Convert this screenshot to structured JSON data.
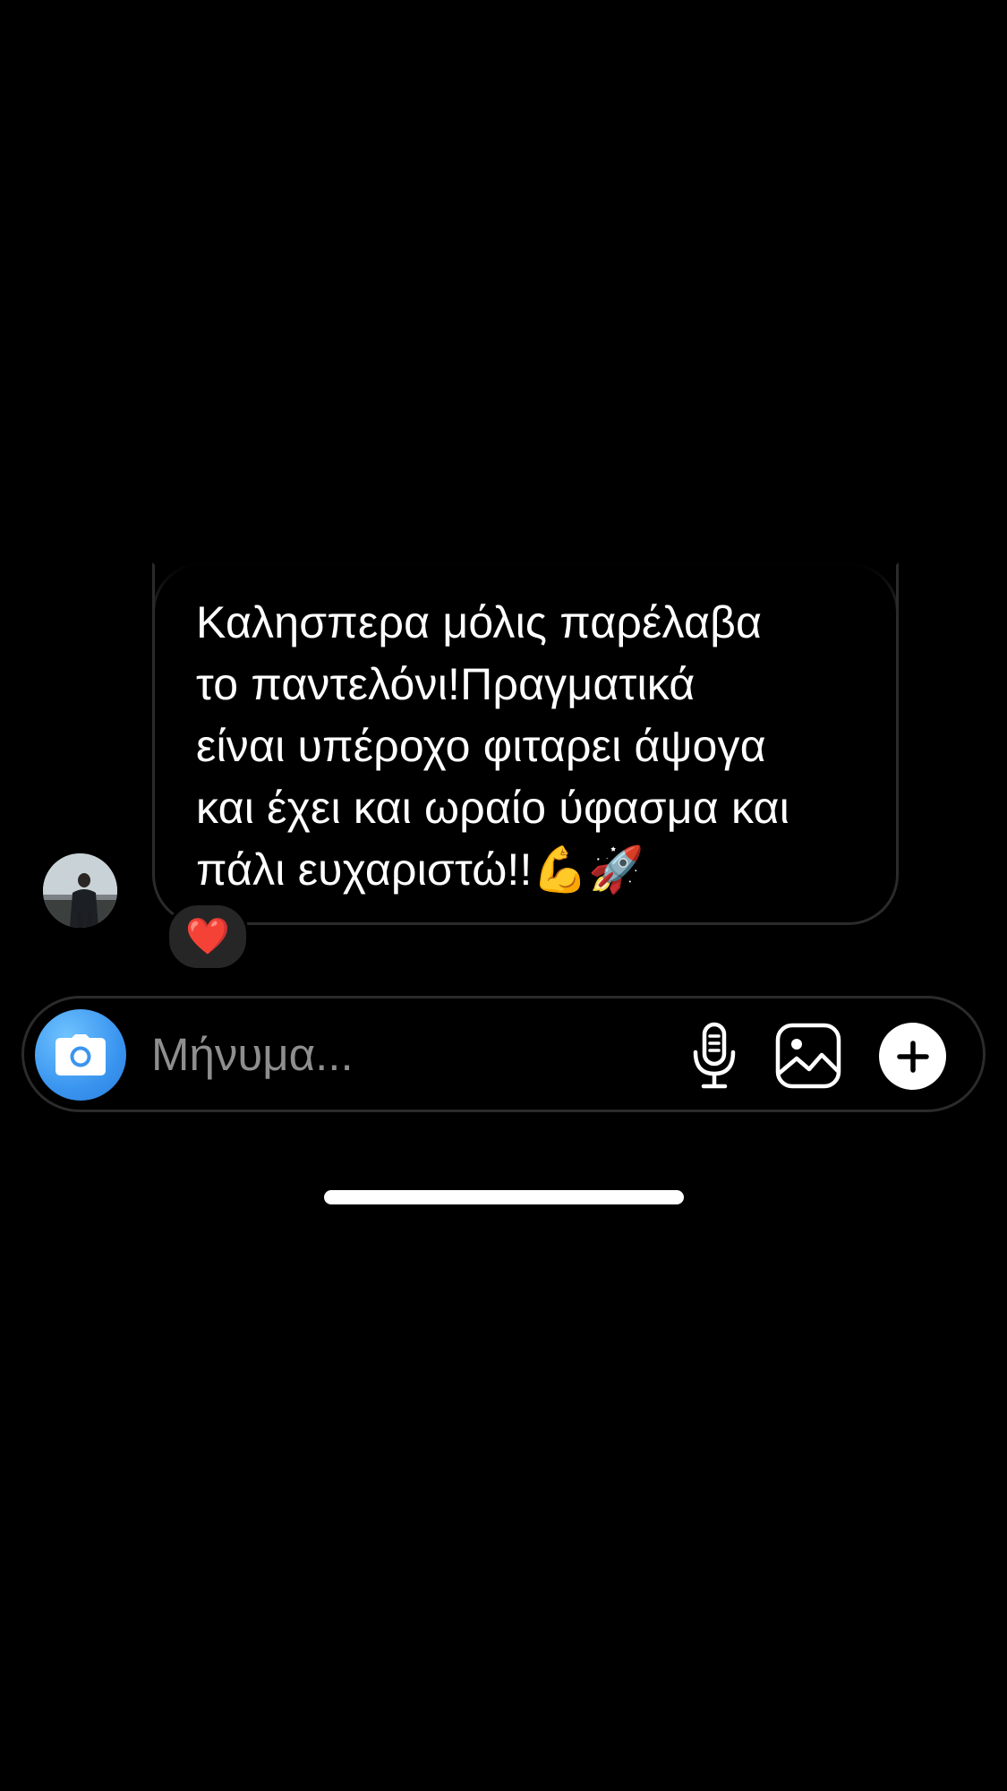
{
  "conversation": {
    "message": {
      "text": "Καλησπερα μόλις παρέλαβα\nτο παντελόνι!Πραγματικά\nείναι υπέροχο φιταρει άψογα\nκαι έχει και ωραίο ύφασμα και\nπάλι ευχαριστώ!!💪🚀",
      "reaction": "❤️"
    },
    "sender_avatar_icon": "profile-photo"
  },
  "composer": {
    "placeholder": "Μήνυμα...",
    "camera_icon": "camera-icon",
    "mic_icon": "microphone-icon",
    "gallery_icon": "gallery-icon",
    "plus_icon": "plus-icon",
    "camera_color": "#3a95ef"
  }
}
